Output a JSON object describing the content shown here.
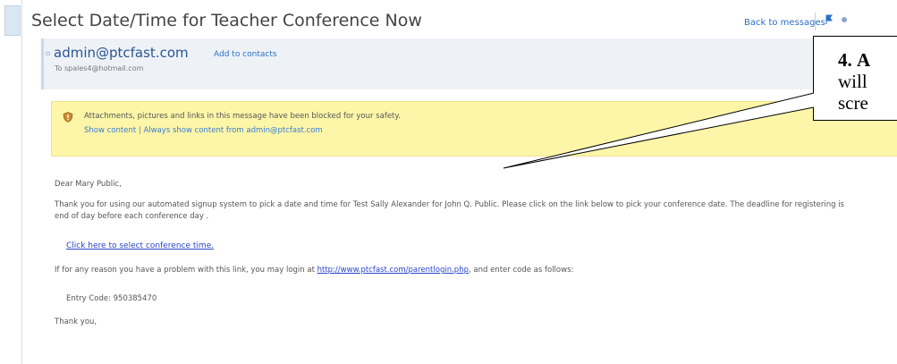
{
  "message": {
    "subject": "Select Date/Time for Teacher Conference Now",
    "back_to_messages": "Back to messages",
    "sender_email": "admin@ptcfast.com",
    "add_to_contacts": "Add to contacts",
    "to_line": "To spales4@hotmail.com"
  },
  "warning": {
    "text": "Attachments, pictures and links in this message have been blocked for your safety.",
    "show_content": "Show content",
    "separator": " | ",
    "always_show": "Always show content from admin@ptcfast.com"
  },
  "body": {
    "greeting": "Dear Mary Public,",
    "paragraph1": "Thank you for using our automated signup system to pick a date and time for Test Sally Alexander for John Q. Public.  Please click on the link below to pick your conference date. The deadline for registering is end of day before each conference day .",
    "link_text": "Click here to select conference time.",
    "paragraph2_before": "If for any reason you have a problem with this link, you may login at ",
    "paragraph2_url": "http://www.ptcfast.com/parentlogin.php",
    "paragraph2_after": ", and enter code as follows:",
    "entry_code": "Entry Code: 950385470",
    "thanks": "Thank you,"
  },
  "callout": {
    "number": "4.",
    "line1_rest": "A",
    "line2": "will",
    "line3": "scre"
  },
  "colors": {
    "link": "#2a6fc9",
    "warning_bg": "#fdf6a8",
    "sender_bg": "#eef2f7"
  }
}
